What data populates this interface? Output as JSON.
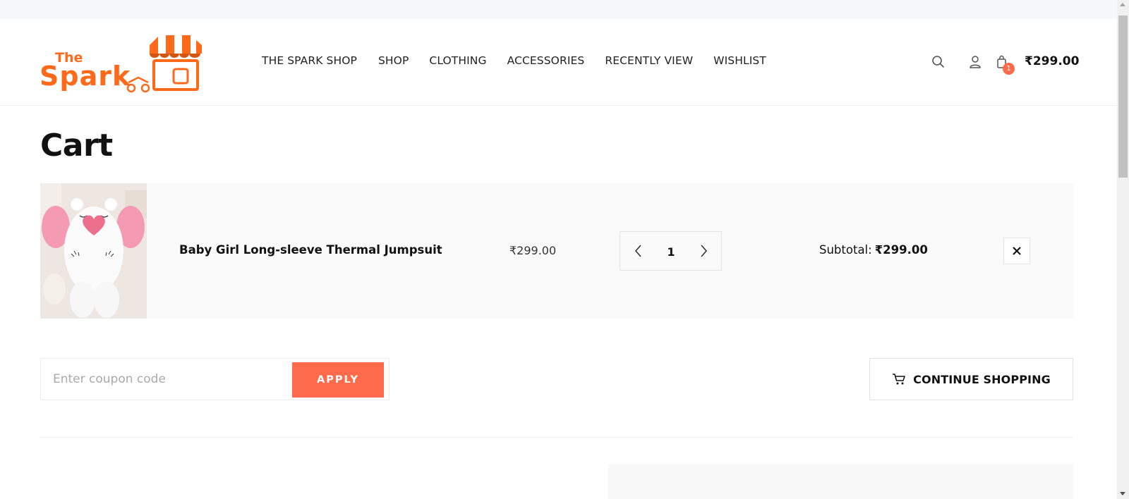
{
  "brand": {
    "logo_top_text": "The",
    "logo_main_text": "Spark",
    "accent_color": "#ff6a1a",
    "name": "The Spark Shop"
  },
  "nav": {
    "items": [
      {
        "label": "THE SPARK SHOP"
      },
      {
        "label": "SHOP"
      },
      {
        "label": "CLOTHING"
      },
      {
        "label": "ACCESSORIES"
      },
      {
        "label": "RECENTLY VIEW"
      },
      {
        "label": "WISHLIST"
      }
    ]
  },
  "header": {
    "search_icon": "search-icon",
    "account_icon": "user-icon",
    "cart_icon": "shopping-bag-icon",
    "cart_count": "1",
    "cart_total": "₹299.00"
  },
  "page": {
    "title": "Cart"
  },
  "cart": {
    "items": [
      {
        "name": "Baby Girl Long-sleeve Thermal Jumpsuit",
        "price": "₹299.00",
        "quantity": "1",
        "subtotal_label": "Subtotal:",
        "subtotal_value": "₹299.00"
      }
    ]
  },
  "coupon": {
    "placeholder": "Enter coupon code",
    "value": "",
    "apply_label": "APPLY"
  },
  "actions": {
    "continue_label": "CONTINUE SHOPPING",
    "continue_icon": "cart-icon"
  },
  "colors": {
    "primary": "#ff6a4a",
    "text": "#111111",
    "row_bg": "#fafafa"
  }
}
